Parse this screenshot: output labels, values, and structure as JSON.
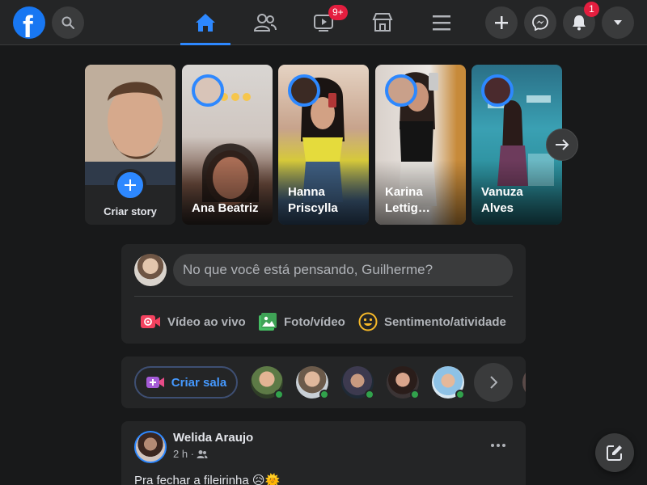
{
  "colors": {
    "accent": "#2d88ff",
    "brand": "#1877f2",
    "badge": "#e41e3f",
    "online": "#31a24c",
    "surface": "#242526",
    "background": "#18191a"
  },
  "topbar": {
    "logo_letter": "f",
    "search_icon": "search-icon",
    "nav": [
      {
        "icon": "home-icon",
        "active": true
      },
      {
        "icon": "friends-icon",
        "active": false
      },
      {
        "icon": "watch-icon",
        "active": false,
        "badge": "9+"
      },
      {
        "icon": "marketplace-icon",
        "active": false
      },
      {
        "icon": "menu-icon",
        "active": false
      }
    ],
    "right": [
      {
        "icon": "plus-icon"
      },
      {
        "icon": "messenger-icon"
      },
      {
        "icon": "bell-icon",
        "badge": "1"
      },
      {
        "icon": "chevron-down-icon"
      }
    ]
  },
  "stories": {
    "create_label": "Criar story",
    "items": [
      {
        "name": "Ana Beatriz"
      },
      {
        "name": "Hanna Priscylla"
      },
      {
        "name": "Karina Lettig…"
      },
      {
        "name": "Vanuza Alves"
      }
    ]
  },
  "composer": {
    "placeholder": "No que você está pensando, Guilherme?",
    "actions": [
      {
        "label": "Vídeo ao vivo",
        "icon": "live-video-icon",
        "color": "#f3425f"
      },
      {
        "label": "Foto/vídeo",
        "icon": "photo-icon",
        "color": "#45bd62"
      },
      {
        "label": "Sentimento/atividade",
        "icon": "feeling-icon",
        "color": "#f7b928"
      }
    ]
  },
  "rooms": {
    "create_label": "Criar sala"
  },
  "post": {
    "author": "Welida Araujo",
    "time": "2 h ·",
    "text": "Pra fechar a fileirinha 😥🌞"
  }
}
